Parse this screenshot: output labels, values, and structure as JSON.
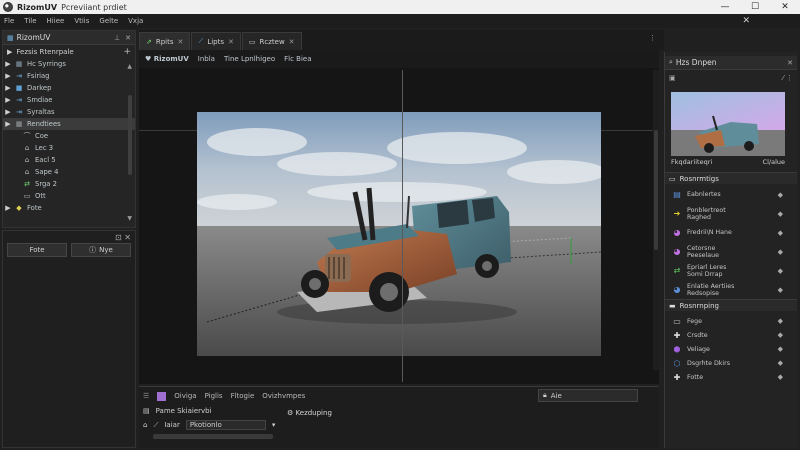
{
  "window": {
    "app_name": "RizomUV",
    "project": "Pcreviiant prdiet",
    "min": "—",
    "max": "☐",
    "close": "✕"
  },
  "menu": {
    "items": [
      "Fle",
      "Tile",
      "Hiiee",
      "Vtiis",
      "Gelte",
      "Vxja"
    ],
    "close": "✕"
  },
  "outliner": {
    "title": "RizomUV",
    "header_label": "Fezsis Rtenrpale",
    "rows": [
      {
        "label": "Hc Syrrings",
        "expander": "▶",
        "icon": "▦",
        "color": "#8aa0b0"
      },
      {
        "label": "Fsiriag",
        "expander": "▶",
        "icon": "⇥",
        "color": "#6fb0e0"
      },
      {
        "label": "Darkep",
        "expander": "▶",
        "icon": "■",
        "color": "#5fa0d0"
      },
      {
        "label": "Smdiae",
        "expander": "▶",
        "icon": "⇥",
        "color": "#6fb0e0"
      },
      {
        "label": "Syraltas",
        "expander": "▶",
        "icon": "⇥",
        "color": "#6fb0e0"
      },
      {
        "label": "Rendtiees",
        "expander": "▶",
        "icon": "▦",
        "color": "#9aa0a5"
      },
      {
        "label": "Coe",
        "expander": "",
        "icon": "⌒",
        "color": "#bbbbbb"
      },
      {
        "label": "Lec 3",
        "expander": "",
        "icon": "⌂",
        "color": "#bbbbbb"
      },
      {
        "label": "Eacl 5",
        "expander": "",
        "icon": "⌂",
        "color": "#bbbbbb"
      },
      {
        "label": "Sape 4",
        "expander": "",
        "icon": "⌂",
        "color": "#bbbbbb"
      },
      {
        "label": "Srga 2",
        "expander": "",
        "icon": "⇄",
        "color": "#6fd06f"
      },
      {
        "label": "Ott",
        "expander": "",
        "icon": "▭",
        "color": "#bbbbbb"
      },
      {
        "label": "Fote",
        "expander": "▶",
        "icon": "◆",
        "color": "#e0d050"
      }
    ]
  },
  "left_bottom": {
    "btn1": "Fote",
    "btn2": "Nye"
  },
  "tabs": [
    {
      "label": "Rpits",
      "icon": "⇗"
    },
    {
      "label": "Lipts",
      "icon": "⟋"
    },
    {
      "label": "Rcztew",
      "icon": "▭"
    }
  ],
  "viewport_toolbar": [
    "RizomUV",
    "Inbla",
    "Tine Lpnlhigeo",
    "Flc Biea"
  ],
  "inspector": {
    "title": "Hzs Dnpen",
    "image_caption": "Fkqdariiteqri",
    "image_tag": "Cl/alue",
    "section1": "Rosnrmtigs",
    "rows1": [
      {
        "label": "Eabnlertes",
        "icon": "▤",
        "color": "#5a8fd8"
      },
      {
        "label": "Ponblertreot\nRaghed",
        "icon": "➔",
        "color": "#e6d030"
      },
      {
        "label": "Fredrii\\N Hane",
        "icon": "◕",
        "color": "#c070e0"
      },
      {
        "label": "Cetorsne\nPeeselaue",
        "icon": "◕",
        "color": "#c070e0"
      },
      {
        "label": "Epriarl Leres\nSomi Drrap",
        "icon": "⇄",
        "color": "#5fc05f"
      },
      {
        "label": "Enlatie Aertiies\nRedsopise",
        "icon": "◕",
        "color": "#5a8fd8"
      }
    ],
    "section2": "Rosnrnping",
    "rows2": [
      {
        "label": "Fege",
        "icon": "▭",
        "color": "#bbbbbb"
      },
      {
        "label": "Crsdte",
        "icon": "✚",
        "color": "#dddddd"
      },
      {
        "label": "Veliage",
        "icon": "⬢",
        "color": "#a060e0"
      },
      {
        "label": "Dsgrhte Dkirs",
        "icon": "⬡",
        "color": "#5a8fd8"
      },
      {
        "label": "Fotte",
        "icon": "✚",
        "color": "#dddddd"
      }
    ]
  },
  "bottom": {
    "tabs": [
      "Oiviga",
      "Piglis",
      "Fltogie",
      "Ovizhvmpes"
    ],
    "filter": "Aie",
    "row1_label": "Pame Skiaiervbi",
    "row2_icon": "Iaiar",
    "row2_field": "Pkotionlo",
    "tag": "Kezduping"
  }
}
